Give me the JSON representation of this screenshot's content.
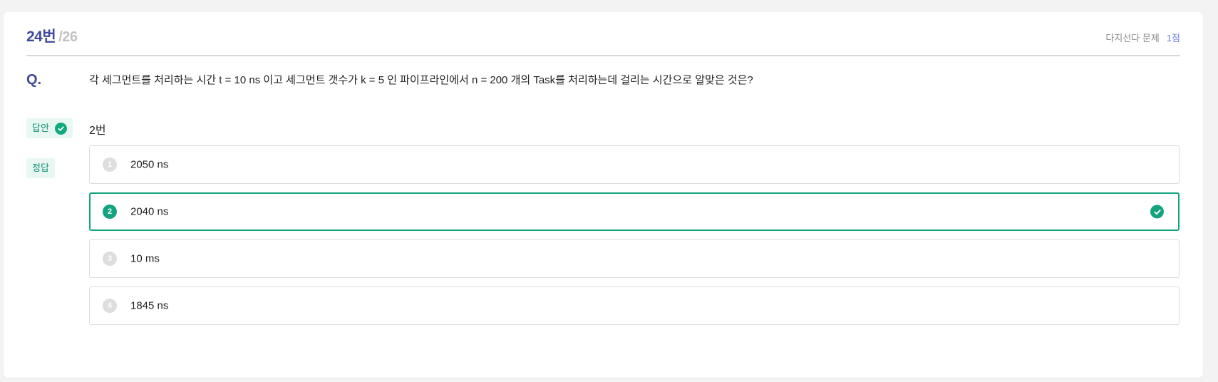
{
  "header": {
    "question_number": "24번",
    "total": "/26",
    "type": "다지선다 문제",
    "points": "1점"
  },
  "question": {
    "label": "Q.",
    "text": "각 세그먼트를 처리하는 시간 t = 10 ns 이고 세그먼트 갯수가 k = 5 인 파이프라인에서 n = 200 개의 Task를 처리하는데 걸리는 시간으로 알맞은 것은?"
  },
  "answer": {
    "label": "답안",
    "value": "2번"
  },
  "correct": {
    "label": "정답"
  },
  "options": [
    {
      "num": "1",
      "text": "2050 ns",
      "selected": false
    },
    {
      "num": "2",
      "text": "2040 ns",
      "selected": true
    },
    {
      "num": "3",
      "text": "10 ms",
      "selected": false
    },
    {
      "num": "4",
      "text": "1845 ns",
      "selected": false
    }
  ],
  "colors": {
    "accent": "#3f4a9a",
    "correct": "#14a37f",
    "points": "#6b7de0"
  },
  "icons": {
    "answer_check": "check-circle-icon",
    "option_check": "check-circle-icon"
  }
}
